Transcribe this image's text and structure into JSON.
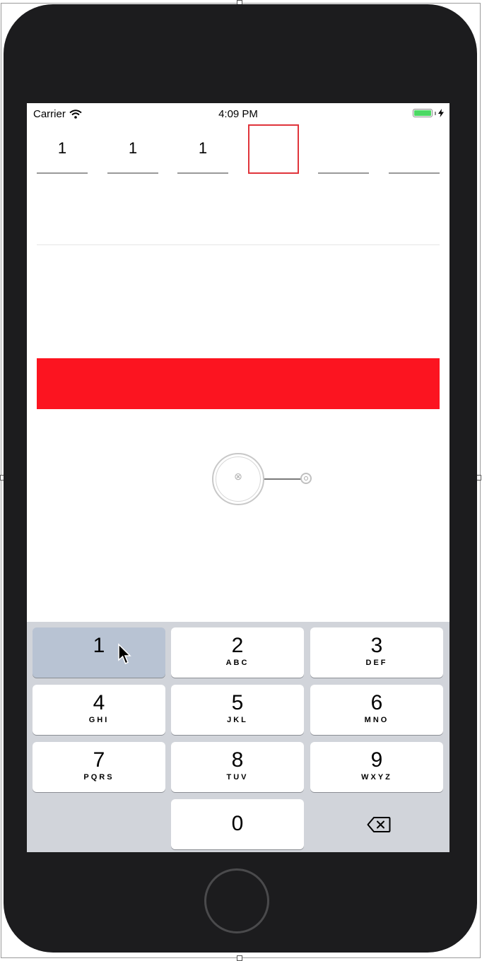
{
  "status_bar": {
    "carrier": "Carrier",
    "time": "4:09 PM",
    "battery_color": "#4cd964"
  },
  "otp": {
    "digits": [
      "1",
      "1",
      "1",
      "",
      "",
      ""
    ],
    "active_index": 3,
    "active_color": "#e0343b"
  },
  "action_bar": {
    "color": "#fc1420"
  },
  "keypad": {
    "keys": [
      {
        "num": "1",
        "letters": ""
      },
      {
        "num": "2",
        "letters": "ABC"
      },
      {
        "num": "3",
        "letters": "DEF"
      },
      {
        "num": "4",
        "letters": "GHI"
      },
      {
        "num": "5",
        "letters": "JKL"
      },
      {
        "num": "6",
        "letters": "MNO"
      },
      {
        "num": "7",
        "letters": "PQRS"
      },
      {
        "num": "8",
        "letters": "TUV"
      },
      {
        "num": "9",
        "letters": "WXYZ"
      },
      {
        "num": "0",
        "letters": ""
      }
    ],
    "pressed_key": "1",
    "delete_icon": "backspace-icon"
  },
  "touch_indicator": {
    "symbol": "⊗"
  }
}
